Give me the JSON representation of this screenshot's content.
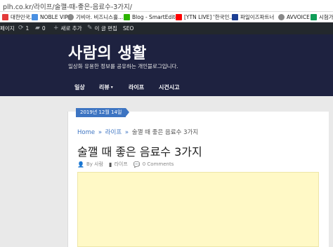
{
  "browser": {
    "url": "plh.co.kr/라이프/술깰-때-좋은-음료수-3가지/",
    "bookmarks": [
      {
        "label": "대한민국...",
        "icon": "flag-icon",
        "color": "#e33b3b"
      },
      {
        "label": "NOBLE VIP",
        "icon": "n-logo-icon",
        "color": "#4a90e2"
      },
      {
        "label": "기비아. 비즈니스흘...",
        "icon": "globe-icon",
        "color": "#777777"
      },
      {
        "label": "Blog - SmartEditor",
        "icon": "naver-blog-icon",
        "color": "#2db400"
      },
      {
        "label": "[YTN LIVE] '한국인...",
        "icon": "youtube-icon",
        "color": "#ff0000"
      },
      {
        "label": "파일이즈파트너",
        "icon": "file-icon",
        "color": "#1c3f94"
      },
      {
        "label": "AVVOICE",
        "icon": "globe-icon",
        "color": "#777777"
      },
      {
        "label": "시험가",
        "icon": "sheet-icon",
        "color": "#0f9d58"
      }
    ]
  },
  "adminbar": {
    "items": [
      {
        "label": "페이지",
        "icon": ""
      },
      {
        "label": "1",
        "icon": "refresh-icon"
      },
      {
        "label": "0",
        "icon": "comment-icon"
      },
      {
        "label": "새로 추가",
        "icon": "plus-icon"
      },
      {
        "label": "이 글 편집",
        "icon": "pencil-icon"
      },
      {
        "label": "SEO",
        "icon": ""
      }
    ]
  },
  "site": {
    "title": "사람의 생활",
    "description": "일상화 유용한 정보를 공유하는 개인블로그입니다."
  },
  "nav": {
    "items": [
      {
        "label": "일상",
        "caret": ""
      },
      {
        "label": "리뷰",
        "caret": "▾"
      },
      {
        "label": "라이프",
        "caret": ""
      },
      {
        "label": "시건시고",
        "caret": ""
      }
    ]
  },
  "post": {
    "date": "2019년 12월 14일",
    "breadcrumb": {
      "home": "Home",
      "category": "라이프",
      "current": "술깰 때 좋은 음료수 3가지",
      "sep": "»"
    },
    "title": "술깰 때 좋은 음료수 3가지",
    "meta": {
      "by": "By 사람",
      "category": "라이프",
      "comments": "0 Comments"
    }
  },
  "colors": {
    "header_bg": "#1e2240",
    "accent": "#3d74c2",
    "admin_bg": "#23282d",
    "featured_bg": "#fff9c6"
  }
}
